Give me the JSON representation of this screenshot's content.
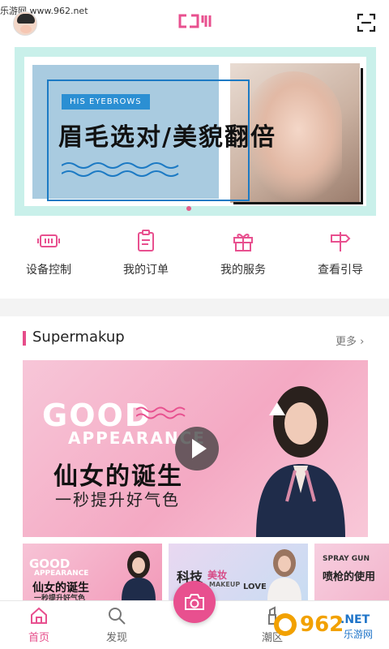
{
  "watermark_top": "乐游网 www.962.net",
  "header": {
    "logo": "CJ'I"
  },
  "banner": {
    "tag": "HIS EYEBROWS",
    "title": "眉毛选对/美貌翻倍"
  },
  "quick_menu": [
    {
      "label": "设备控制",
      "icon": "device-icon"
    },
    {
      "label": "我的订单",
      "icon": "order-icon"
    },
    {
      "label": "我的服务",
      "icon": "gift-icon"
    },
    {
      "label": "查看引导",
      "icon": "signpost-icon"
    }
  ],
  "section": {
    "title": "Supermakup",
    "more": "更多 ›"
  },
  "promo": {
    "good": "GOOD",
    "appearance": "APPEARANCE",
    "title": "仙女的诞生",
    "subtitle": "一秒提升好气色"
  },
  "thumbs": [
    {
      "line1": "GOOD",
      "line2": "APPEARANCE",
      "line3": "仙女的诞生",
      "line4": "一秒提升好气色"
    },
    {
      "line1": "科技",
      "line2": "美妆",
      "line3": "MAKEUP",
      "line4": "LOVE"
    },
    {
      "line1": "SPRAY GUN",
      "line2": "喷枪的使用"
    }
  ],
  "nav": {
    "home": "首页",
    "discover": "发现",
    "trend": "潮区"
  },
  "watermark_bottom": {
    "brand": "962",
    "suffix": ".NET",
    "sub": "乐游网"
  },
  "colors": {
    "accent": "#e64d8a",
    "banner_bg": "#c9f0ea",
    "promo_bg": "#f4a9c3"
  }
}
